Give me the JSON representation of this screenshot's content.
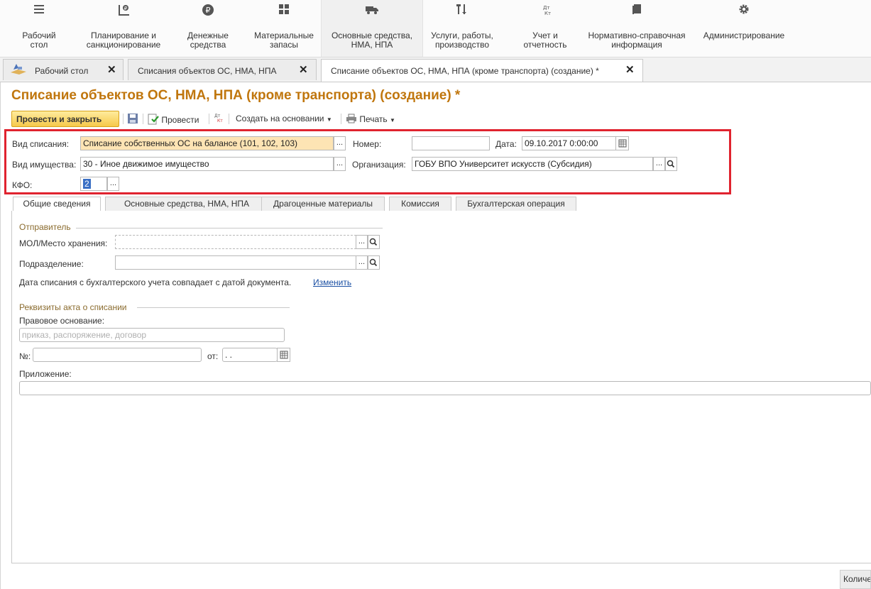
{
  "sections": [
    {
      "label": "Рабочий\nстол",
      "icon": "menu-icon"
    },
    {
      "label": "Планирование и\nсанкционирование",
      "icon": "planning-icon"
    },
    {
      "label": "Денежные\nсредства",
      "icon": "ruble-icon"
    },
    {
      "label": "Материальные\nзапасы",
      "icon": "grid-icon"
    },
    {
      "label": "Основные средства,\nНМА, НПА",
      "icon": "truck-icon"
    },
    {
      "label": "Услуги, работы,\nпроизводство",
      "icon": "tools-icon"
    },
    {
      "label": "Учет и\nотчетность",
      "icon": "debit-credit-icon"
    },
    {
      "label": "Нормативно-справочная\nинформация",
      "icon": "book-icon"
    },
    {
      "label": "Администрирование",
      "icon": "gear-icon"
    }
  ],
  "tabs": [
    {
      "label": "Рабочий стол"
    },
    {
      "label": "Списания объектов ОС, НМА, НПА"
    },
    {
      "label": "Списание объектов ОС, НМА, НПА (кроме транспорта) (создание) *"
    }
  ],
  "doc": {
    "title": "Списание объектов ОС, НМА, НПА (кроме транспорта) (создание) *"
  },
  "toolbar": {
    "post_close": "Провести и закрыть",
    "post": "Провести",
    "create_basis": "Создать на основании",
    "print": "Печать"
  },
  "header": {
    "write_off_type_label": "Вид списания:",
    "write_off_type_value": "Списание собственных ОС на балансе (101, 102, 103)",
    "number_label": "Номер:",
    "number_value": "",
    "date_label": "Дата:",
    "date_value": "09.10.2017  0:00:00",
    "property_type_label": "Вид имущества:",
    "property_type_value": "30 - Иное движимое имущество",
    "org_label": "Организация:",
    "org_value": "ГОБУ ВПО Университет искусств (Субсидия)",
    "kfo_label": "КФО:",
    "kfo_value": "2"
  },
  "inner_tabs": [
    {
      "label": "Общие сведения"
    },
    {
      "label": "Основные средства, НМА, НПА"
    },
    {
      "label": "Драгоценные материалы"
    },
    {
      "label": "Комиссия"
    },
    {
      "label": "Бухгалтерская операция"
    }
  ],
  "general": {
    "sender_group": "Отправитель",
    "mol_label": "МОЛ/Место хранения:",
    "mol_value": "",
    "dept_label": "Подразделение:",
    "dept_value": "",
    "date_note": "Дата списания с бухгалтерского учета совпадает с датой документа.",
    "change_link": "Изменить",
    "act_group": "Реквизиты акта о списании",
    "legal_basis_label": "Правовое основание:",
    "legal_basis_placeholder": "приказ, распоряжение, договор",
    "num_label": "№:",
    "num_value": "",
    "from_label": "от:",
    "from_value": " .  . ",
    "attachment_label": "Приложение:",
    "attachment_value": ""
  },
  "bottom": {
    "button_label": "Количество"
  }
}
